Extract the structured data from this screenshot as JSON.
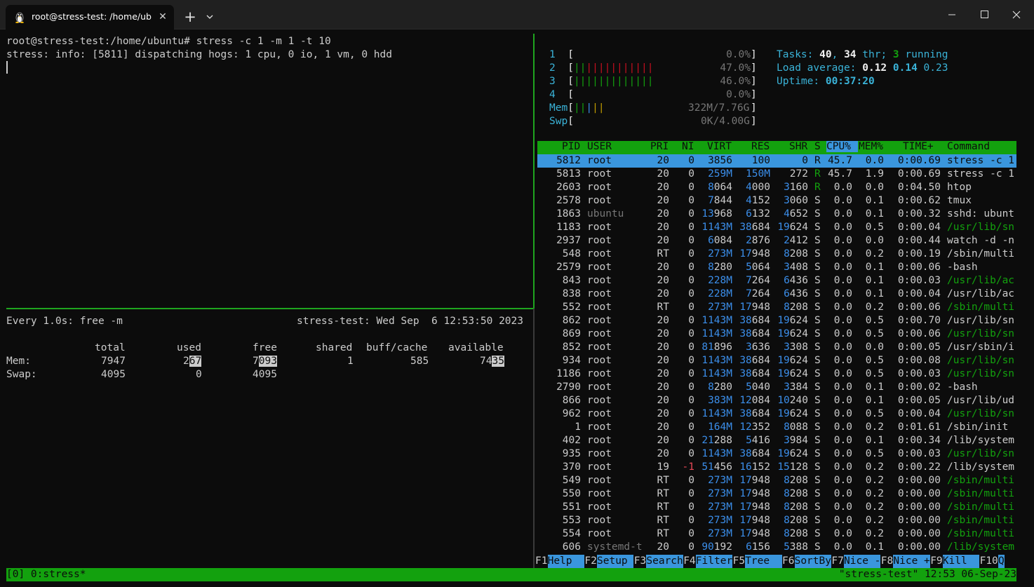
{
  "window": {
    "tab_title": "root@stress-test: /home/ubu",
    "icons": [
      "linux-tux-icon",
      "close-icon",
      "plus-icon",
      "chevron-down-icon",
      "minimize-icon",
      "maximize-icon",
      "window-close-icon"
    ]
  },
  "left_top": {
    "lines": [
      "root@stress-test:/home/ubuntu# stress -c 1 -m 1 -t 10",
      "stress: info: [5811] dispatching hogs: 1 cpu, 0 io, 1 vm, 0 hdd"
    ]
  },
  "watch": {
    "header_left": "Every 1.0s: free -m",
    "header_right": "stress-test: Wed Sep  6 12:53:50 2023",
    "columns": [
      "total",
      "used",
      "free",
      "shared",
      "buff/cache",
      "available"
    ],
    "mem_label": "Mem:",
    "mem": {
      "total": "7947",
      "used_a": "2",
      "used_b": "67",
      "free_a": "7",
      "free_b": "093",
      "shared": "1",
      "buff": "585",
      "avail_a": "74",
      "avail_b": "35"
    },
    "swap_label": "Swap:",
    "swap": {
      "total": "4095",
      "used": "0",
      "free": "4095"
    }
  },
  "htop": {
    "cpus": [
      {
        "id": "1",
        "bars_green": "",
        "bars_red": "",
        "pct": "0.0%"
      },
      {
        "id": "2",
        "bars_green": "||",
        "bars_red": "|||||||||||",
        "pct": "47.0%"
      },
      {
        "id": "3",
        "bars_green": "|||||||||||||",
        "bars_red": "",
        "pct": "46.0%"
      },
      {
        "id": "4",
        "bars_green": "",
        "bars_red": "",
        "pct": "0.0%"
      }
    ],
    "mem_label": "Mem",
    "mem_bars_green": "||",
    "mem_bars_blue": "|",
    "mem_bars_yellow": "||",
    "mem_value": "322M/7.76G",
    "swp_label": "Swp",
    "swp_value": "0K/4.00G",
    "tasks_label": "Tasks:",
    "tasks_count": "40",
    "tasks_sep1": ",",
    "tasks_thr": "34",
    "tasks_thr_label": "thr;",
    "tasks_running": "3",
    "tasks_running_label": "running",
    "load_label": "Load average:",
    "load1": "0.12",
    "load5": "0.14",
    "load15": "0.23",
    "uptime_label": "Uptime:",
    "uptime": "00:37:20",
    "columns": {
      "pid": "PID",
      "user": "USER",
      "pri": "PRI",
      "ni": "NI",
      "virt": "VIRT",
      "res": "RES",
      "shr": "SHR",
      "s": "S",
      "cpu": "CPU%",
      "mem": "MEM%",
      "time": "TIME+",
      "cmd": "Command"
    },
    "processes": [
      {
        "pid": "5812",
        "user": "root",
        "pri": "20",
        "ni": "0",
        "virt": "3856",
        "res": "100",
        "shr": "0",
        "s": "R",
        "cpu": "45.7",
        "mem": "0.0",
        "time": "0:00.69",
        "cmd": "stress -c 1",
        "cmd_green": false
      },
      {
        "pid": "5813",
        "user": "root",
        "pri": "20",
        "ni": "0",
        "virt": "259M",
        "res": "150M",
        "shr": "272",
        "s": "R",
        "cpu": "45.7",
        "mem": "1.9",
        "time": "0:00.69",
        "cmd": "stress -c 1",
        "cmd_green": false
      },
      {
        "pid": "2603",
        "user": "root",
        "pri": "20",
        "ni": "0",
        "virt": "8064",
        "res": "4000",
        "shr": "3160",
        "s": "R",
        "cpu": "0.0",
        "mem": "0.0",
        "time": "0:04.50",
        "cmd": "htop",
        "cmd_green": false
      },
      {
        "pid": "2578",
        "user": "root",
        "pri": "20",
        "ni": "0",
        "virt": "7844",
        "res": "4152",
        "shr": "3060",
        "s": "S",
        "cpu": "0.0",
        "mem": "0.1",
        "time": "0:00.62",
        "cmd": "tmux",
        "cmd_green": false
      },
      {
        "pid": "1863",
        "user": "ubuntu",
        "pri": "20",
        "ni": "0",
        "virt": "13968",
        "res": "6132",
        "shr": "4652",
        "s": "S",
        "cpu": "0.0",
        "mem": "0.1",
        "time": "0:00.32",
        "cmd": "sshd: ubunt",
        "cmd_green": false
      },
      {
        "pid": "1183",
        "user": "root",
        "pri": "20",
        "ni": "0",
        "virt": "1143M",
        "res": "38684",
        "shr": "19624",
        "s": "S",
        "cpu": "0.0",
        "mem": "0.5",
        "time": "0:00.04",
        "cmd": "/usr/lib/sn",
        "cmd_green": true
      },
      {
        "pid": "2937",
        "user": "root",
        "pri": "20",
        "ni": "0",
        "virt": "6084",
        "res": "2876",
        "shr": "2412",
        "s": "S",
        "cpu": "0.0",
        "mem": "0.0",
        "time": "0:00.44",
        "cmd": "watch -d -n",
        "cmd_green": false
      },
      {
        "pid": "548",
        "user": "root",
        "pri": "RT",
        "ni": "0",
        "virt": "273M",
        "res": "17948",
        "shr": "8208",
        "s": "S",
        "cpu": "0.0",
        "mem": "0.2",
        "time": "0:00.19",
        "cmd": "/sbin/multi",
        "cmd_green": false
      },
      {
        "pid": "2579",
        "user": "root",
        "pri": "20",
        "ni": "0",
        "virt": "8280",
        "res": "5064",
        "shr": "3408",
        "s": "S",
        "cpu": "0.0",
        "mem": "0.1",
        "time": "0:00.06",
        "cmd": "-bash",
        "cmd_green": false
      },
      {
        "pid": "843",
        "user": "root",
        "pri": "20",
        "ni": "0",
        "virt": "228M",
        "res": "7264",
        "shr": "6436",
        "s": "S",
        "cpu": "0.0",
        "mem": "0.1",
        "time": "0:00.03",
        "cmd": "/usr/lib/ac",
        "cmd_green": true
      },
      {
        "pid": "838",
        "user": "root",
        "pri": "20",
        "ni": "0",
        "virt": "228M",
        "res": "7264",
        "shr": "6436",
        "s": "S",
        "cpu": "0.0",
        "mem": "0.1",
        "time": "0:00.04",
        "cmd": "/usr/lib/ac",
        "cmd_green": false
      },
      {
        "pid": "552",
        "user": "root",
        "pri": "RT",
        "ni": "0",
        "virt": "273M",
        "res": "17948",
        "shr": "8208",
        "s": "S",
        "cpu": "0.0",
        "mem": "0.2",
        "time": "0:00.06",
        "cmd": "/sbin/multi",
        "cmd_green": true
      },
      {
        "pid": "862",
        "user": "root",
        "pri": "20",
        "ni": "0",
        "virt": "1143M",
        "res": "38684",
        "shr": "19624",
        "s": "S",
        "cpu": "0.0",
        "mem": "0.5",
        "time": "0:00.70",
        "cmd": "/usr/lib/sn",
        "cmd_green": false
      },
      {
        "pid": "869",
        "user": "root",
        "pri": "20",
        "ni": "0",
        "virt": "1143M",
        "res": "38684",
        "shr": "19624",
        "s": "S",
        "cpu": "0.0",
        "mem": "0.5",
        "time": "0:00.06",
        "cmd": "/usr/lib/sn",
        "cmd_green": true
      },
      {
        "pid": "852",
        "user": "root",
        "pri": "20",
        "ni": "0",
        "virt": "81896",
        "res": "3636",
        "shr": "3308",
        "s": "S",
        "cpu": "0.0",
        "mem": "0.0",
        "time": "0:00.05",
        "cmd": "/usr/sbin/i",
        "cmd_green": false
      },
      {
        "pid": "934",
        "user": "root",
        "pri": "20",
        "ni": "0",
        "virt": "1143M",
        "res": "38684",
        "shr": "19624",
        "s": "S",
        "cpu": "0.0",
        "mem": "0.5",
        "time": "0:00.08",
        "cmd": "/usr/lib/sn",
        "cmd_green": true
      },
      {
        "pid": "1186",
        "user": "root",
        "pri": "20",
        "ni": "0",
        "virt": "1143M",
        "res": "38684",
        "shr": "19624",
        "s": "S",
        "cpu": "0.0",
        "mem": "0.5",
        "time": "0:00.03",
        "cmd": "/usr/lib/sn",
        "cmd_green": true
      },
      {
        "pid": "2790",
        "user": "root",
        "pri": "20",
        "ni": "0",
        "virt": "8280",
        "res": "5040",
        "shr": "3384",
        "s": "S",
        "cpu": "0.0",
        "mem": "0.1",
        "time": "0:00.02",
        "cmd": "-bash",
        "cmd_green": false
      },
      {
        "pid": "866",
        "user": "root",
        "pri": "20",
        "ni": "0",
        "virt": "383M",
        "res": "12084",
        "shr": "10240",
        "s": "S",
        "cpu": "0.0",
        "mem": "0.1",
        "time": "0:00.05",
        "cmd": "/usr/lib/ud",
        "cmd_green": false
      },
      {
        "pid": "962",
        "user": "root",
        "pri": "20",
        "ni": "0",
        "virt": "1143M",
        "res": "38684",
        "shr": "19624",
        "s": "S",
        "cpu": "0.0",
        "mem": "0.5",
        "time": "0:00.04",
        "cmd": "/usr/lib/sn",
        "cmd_green": true
      },
      {
        "pid": "1",
        "user": "root",
        "pri": "20",
        "ni": "0",
        "virt": "164M",
        "res": "12352",
        "shr": "8088",
        "s": "S",
        "cpu": "0.0",
        "mem": "0.2",
        "time": "0:01.61",
        "cmd": "/sbin/init",
        "cmd_green": false
      },
      {
        "pid": "402",
        "user": "root",
        "pri": "20",
        "ni": "0",
        "virt": "21288",
        "res": "5416",
        "shr": "3984",
        "s": "S",
        "cpu": "0.0",
        "mem": "0.1",
        "time": "0:00.34",
        "cmd": "/lib/system",
        "cmd_green": false
      },
      {
        "pid": "935",
        "user": "root",
        "pri": "20",
        "ni": "0",
        "virt": "1143M",
        "res": "38684",
        "shr": "19624",
        "s": "S",
        "cpu": "0.0",
        "mem": "0.5",
        "time": "0:00.03",
        "cmd": "/usr/lib/sn",
        "cmd_green": true
      },
      {
        "pid": "370",
        "user": "root",
        "pri": "19",
        "ni": "-1",
        "virt": "51456",
        "res": "16152",
        "shr": "15128",
        "s": "S",
        "cpu": "0.0",
        "mem": "0.2",
        "time": "0:00.22",
        "cmd": "/lib/system",
        "cmd_green": false
      },
      {
        "pid": "549",
        "user": "root",
        "pri": "RT",
        "ni": "0",
        "virt": "273M",
        "res": "17948",
        "shr": "8208",
        "s": "S",
        "cpu": "0.0",
        "mem": "0.2",
        "time": "0:00.00",
        "cmd": "/sbin/multi",
        "cmd_green": true
      },
      {
        "pid": "550",
        "user": "root",
        "pri": "RT",
        "ni": "0",
        "virt": "273M",
        "res": "17948",
        "shr": "8208",
        "s": "S",
        "cpu": "0.0",
        "mem": "0.2",
        "time": "0:00.00",
        "cmd": "/sbin/multi",
        "cmd_green": true
      },
      {
        "pid": "551",
        "user": "root",
        "pri": "RT",
        "ni": "0",
        "virt": "273M",
        "res": "17948",
        "shr": "8208",
        "s": "S",
        "cpu": "0.0",
        "mem": "0.2",
        "time": "0:00.00",
        "cmd": "/sbin/multi",
        "cmd_green": true
      },
      {
        "pid": "553",
        "user": "root",
        "pri": "RT",
        "ni": "0",
        "virt": "273M",
        "res": "17948",
        "shr": "8208",
        "s": "S",
        "cpu": "0.0",
        "mem": "0.2",
        "time": "0:00.00",
        "cmd": "/sbin/multi",
        "cmd_green": true
      },
      {
        "pid": "554",
        "user": "root",
        "pri": "RT",
        "ni": "0",
        "virt": "273M",
        "res": "17948",
        "shr": "8208",
        "s": "S",
        "cpu": "0.0",
        "mem": "0.2",
        "time": "0:00.00",
        "cmd": "/sbin/multi",
        "cmd_green": true
      },
      {
        "pid": "606",
        "user": "systemd-t",
        "pri": "20",
        "ni": "0",
        "virt": "90192",
        "res": "6156",
        "shr": "5388",
        "s": "S",
        "cpu": "0.0",
        "mem": "0.1",
        "time": "0:00.00",
        "cmd": "/lib/system",
        "cmd_green": true
      }
    ],
    "fkeys": [
      {
        "key": "F1",
        "label": "Help  "
      },
      {
        "key": "F2",
        "label": "Setup "
      },
      {
        "key": "F3",
        "label": "Search"
      },
      {
        "key": "F4",
        "label": "Filter"
      },
      {
        "key": "F5",
        "label": "Tree  "
      },
      {
        "key": "F6",
        "label": "SortBy"
      },
      {
        "key": "F7",
        "label": "Nice -"
      },
      {
        "key": "F8",
        "label": "Nice +"
      },
      {
        "key": "F9",
        "label": "Kill  "
      },
      {
        "key": "F10",
        "label": "Q"
      }
    ]
  },
  "tmux_status": {
    "left": "[0] 0:stress*",
    "right": "\"stress-test\" 12:53 06-Sep-23"
  },
  "colors": {
    "green": "#13a10e",
    "blue": "#3a96dd",
    "background": "#0c0c0c",
    "titlebar": "#202020"
  }
}
